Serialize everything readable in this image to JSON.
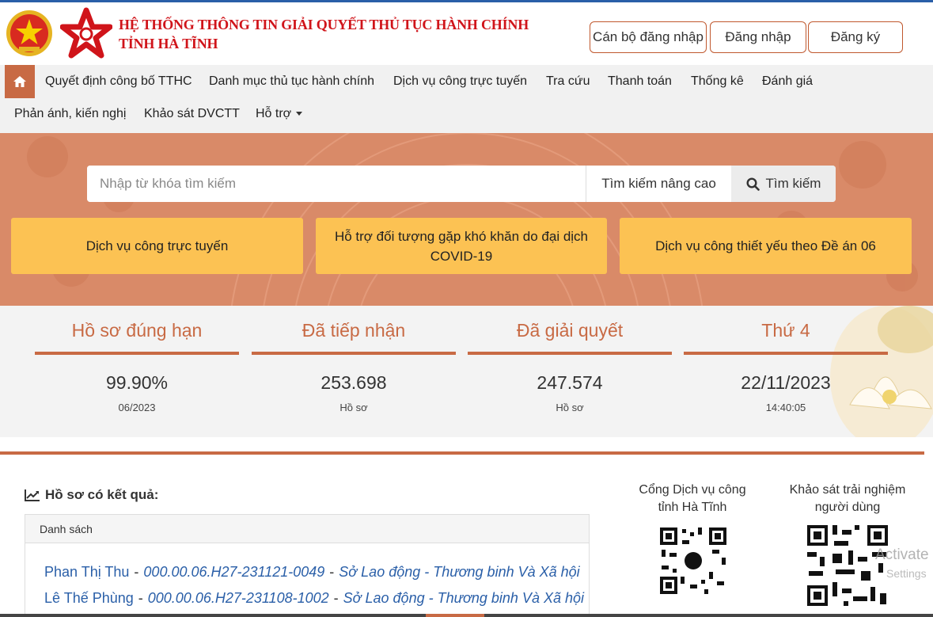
{
  "header": {
    "title_line1": "HỆ THỐNG THÔNG TIN GIẢI QUYẾT THỦ TỤC HÀNH CHÍNH",
    "title_line2": "TỈNH HÀ TĨNH",
    "staff_login": "Cán bộ đăng nhập",
    "login": "Đăng nhập",
    "register": "Đăng ký"
  },
  "nav": {
    "items": [
      "Quyết định công bố TTHC",
      "Danh mục thủ tục hành chính",
      "Dịch vụ công trực tuyến",
      "Tra cứu",
      "Thanh toán",
      "Thống kê",
      "Đánh giá",
      "Phản ánh, kiến nghị",
      "Khảo sát DVCTT",
      "Hỗ trợ"
    ]
  },
  "search": {
    "placeholder": "Nhập từ khóa tìm kiếm",
    "advanced": "Tìm kiếm nâng cao",
    "button": "Tìm kiếm"
  },
  "cards": [
    "Dịch vụ công trực tuyến",
    "Hỗ trợ đối tượng gặp khó khăn do đại dịch COVID-19",
    "Dịch vụ công thiết yếu theo Đề án 06"
  ],
  "stats": [
    {
      "title": "Hồ sơ đúng hạn",
      "value": "99.90%",
      "sub": "06/2023"
    },
    {
      "title": "Đã tiếp nhận",
      "value": "253.698",
      "sub": "Hồ sơ"
    },
    {
      "title": "Đã giải quyết",
      "value": "247.574",
      "sub": "Hồ sơ"
    },
    {
      "title": "Thứ 4",
      "value": "22/11/2023",
      "sub": "14:40:05"
    }
  ],
  "results": {
    "title": "Hồ sơ có kết quả:",
    "panel_heading": "Danh sách",
    "rows": [
      {
        "name": "Phan Thị Thu",
        "code": "000.00.06.H27-231121-0049",
        "agency": "Sở Lao động - Thương binh Và Xã hội"
      },
      {
        "name": "Lê Thế Phùng",
        "code": "000.00.06.H27-231108-1002",
        "agency": "Sở Lao động - Thương binh Và Xã hội"
      }
    ],
    "separator": "-"
  },
  "qr": {
    "portal_label": "Cổng Dịch vụ công tỉnh Hà Tĩnh",
    "survey_label": "Khảo sát trải nghiệm người dùng"
  },
  "watermark": {
    "line1": "Activate Wi",
    "line2": "Settings"
  },
  "colors": {
    "accent": "#c86a44",
    "card": "#fcc253",
    "title_red": "#d0141a",
    "link_blue": "#2a5fa8"
  }
}
